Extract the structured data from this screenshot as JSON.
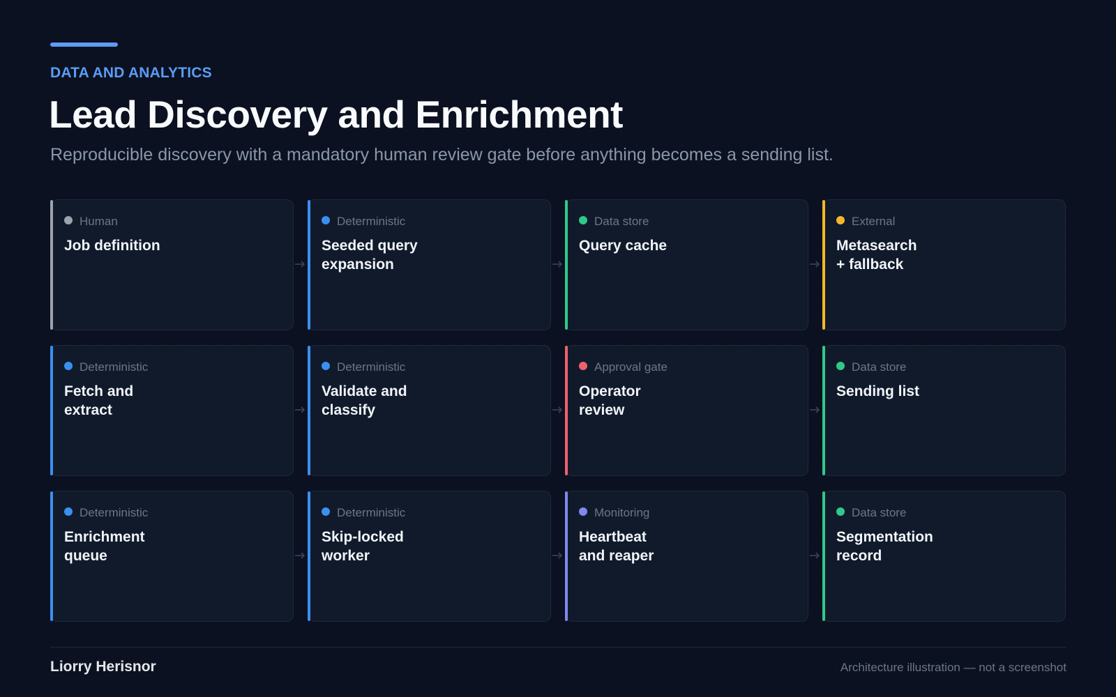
{
  "header": {
    "eyebrow": "DATA AND ANALYTICS",
    "title": "Lead Discovery and Enrichment",
    "subtitle": "Reproducible discovery with a mandatory human review gate before anything becomes a sending list."
  },
  "legend_colors": {
    "Human": "#9ca3af",
    "Deterministic": "#3b8ff0",
    "Data store": "#2fc98a",
    "External": "#f5b728",
    "Approval gate": "#f0606e",
    "Monitoring": "#8088f0"
  },
  "accent_color": "#5b9cf5",
  "connector_icon": "arrow-right-icon",
  "cards": [
    {
      "kind": "Human",
      "label": "Job definition",
      "color": "#9ca3af"
    },
    {
      "kind": "Deterministic",
      "label": "Seeded query\nexpansion",
      "color": "#3b8ff0"
    },
    {
      "kind": "Data store",
      "label": "Query cache",
      "color": "#2fc98a"
    },
    {
      "kind": "External",
      "label": "Metasearch\n+ fallback",
      "color": "#f5b728"
    },
    {
      "kind": "Deterministic",
      "label": "Fetch and\nextract",
      "color": "#3b8ff0"
    },
    {
      "kind": "Deterministic",
      "label": "Validate and\nclassify",
      "color": "#3b8ff0"
    },
    {
      "kind": "Approval gate",
      "label": "Operator\nreview",
      "color": "#f0606e"
    },
    {
      "kind": "Data store",
      "label": "Sending list",
      "color": "#2fc98a"
    },
    {
      "kind": "Deterministic",
      "label": "Enrichment\nqueue",
      "color": "#3b8ff0"
    },
    {
      "kind": "Deterministic",
      "label": "Skip-locked\nworker",
      "color": "#3b8ff0"
    },
    {
      "kind": "Monitoring",
      "label": "Heartbeat\nand reaper",
      "color": "#8088f0"
    },
    {
      "kind": "Data store",
      "label": "Segmentation\nrecord",
      "color": "#2fc98a"
    }
  ],
  "footer": {
    "author": "Liorry Herisnor",
    "note": "Architecture illustration — not a screenshot"
  }
}
